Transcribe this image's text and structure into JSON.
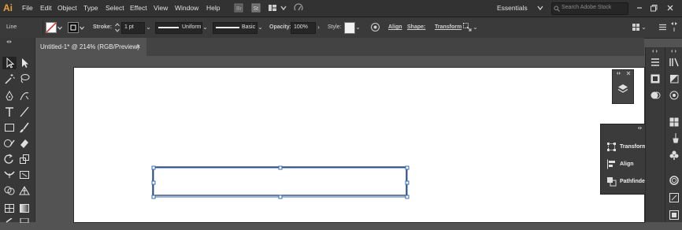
{
  "app": {
    "logo": "Ai"
  },
  "menu": [
    "File",
    "Edit",
    "Object",
    "Type",
    "Select",
    "Effect",
    "View",
    "Window",
    "Help"
  ],
  "workspace": {
    "label": "Essentials"
  },
  "search": {
    "placeholder": "Search Adobe Stock"
  },
  "control_bar": {
    "selection_label": "Line",
    "stroke_label": "Stroke:",
    "stroke_value": "1 pt",
    "uniform_label": "Uniform",
    "basic_label": "Basic",
    "opacity_label": "Opacity:",
    "opacity_value": "100%",
    "style_label": "Style:",
    "align_label": "Align",
    "shape_label": "Shape:",
    "transform_label": "Transform"
  },
  "document_tab": {
    "title": "Untitled-1* @ 214% (RGB/Preview)",
    "close": "×"
  },
  "properties_panel": {
    "items": [
      {
        "label": "Transform",
        "icon": "transform-icon"
      },
      {
        "label": "Align",
        "icon": "align-icon"
      },
      {
        "label": "Pathfinder",
        "icon": "pathfinder-icon"
      }
    ]
  },
  "colors": {
    "accent": "#e8a23a",
    "selection": "#3a6bb5"
  }
}
